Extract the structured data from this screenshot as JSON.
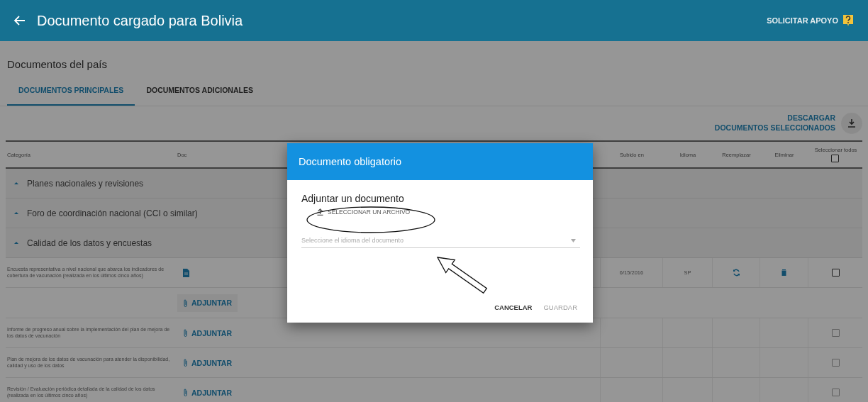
{
  "header": {
    "title": "Documento cargado para Bolivia",
    "help_button": "SOLICITAR APOYO"
  },
  "page_title": "Documentos del país",
  "tabs": [
    {
      "label": "DOCUMENTOS PRINCIPALES",
      "selected": true
    },
    {
      "label": "DOCUMENTOS ADICIONALES",
      "selected": false
    }
  ],
  "download_button": {
    "lines": [
      "DESCARGAR",
      "DOCUMENTOS SELECCIONADOS"
    ]
  },
  "table": {
    "columns": [
      "Categoría",
      "Doc",
      "Subido en",
      "Idioma",
      "Reemplazar",
      "Eliminar",
      "Seleccionar todos"
    ],
    "select_all_checked": false,
    "groups": [
      {
        "title": "Planes nacionales y revisiones"
      },
      {
        "title": "Foro de coordinación nacional (CCI o similar)"
      },
      {
        "title": "Calidad de los datos y encuestas"
      }
    ],
    "rows": [
      {
        "kind": "uploaded",
        "description": "Encuesta representativa a nivel nacional que abarca los indicadores de cobertura de vacunación (realizada en los últimos cinco años)",
        "uploaded": "6/15/2016",
        "language": "SP",
        "attach": "ADJUNTAR",
        "checked": false,
        "disabled": false
      },
      {
        "kind": "empty",
        "description": "Informe de progreso anual sobre la implementación del plan de mejora de los datos de vacunación",
        "attach": "ADJUNTAR",
        "checked": false,
        "disabled": true
      },
      {
        "kind": "empty",
        "description": "Plan de mejora de los datos de vacunación para atender la disponibilidad, calidad y uso de los datos",
        "attach": "ADJUNTAR",
        "checked": false,
        "disabled": true
      },
      {
        "kind": "empty",
        "description": "Revisión / Evaluación periódica detallada de la calidad de los datos (realizada en los últimos cinco años)",
        "attach": "ADJUNTAR",
        "checked": false,
        "disabled": true
      }
    ]
  },
  "dialog": {
    "title": "Documento obligatorio",
    "heading": "Adjuntar un documento",
    "file_button": "SELECCIONAR UN ARCHIVO",
    "language_select": {
      "placeholder": "Seleccione el idioma del documento"
    },
    "buttons": [
      {
        "label": "CANCELAR",
        "disabled": false
      },
      {
        "label": "GUARDAR",
        "disabled": true
      }
    ]
  }
}
